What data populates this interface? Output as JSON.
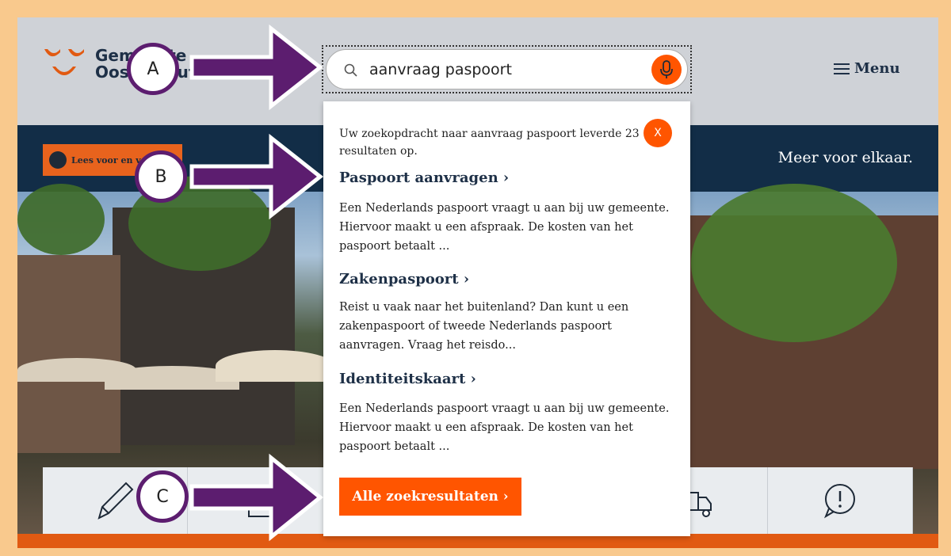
{
  "header": {
    "logo_line1": "Gemeente",
    "logo_line2": "Oosterhout",
    "menu_label": "Menu"
  },
  "search": {
    "value": "aanvraag paspoort",
    "placeholder": ""
  },
  "navband": {
    "read_aloud_label": "Lees voor en vertaal",
    "tagline": "Meer voor elkaar."
  },
  "results": {
    "summary": "Uw zoekopdracht naar aanvraag paspoort leverde 23 resultaten op.",
    "close_label": "X",
    "items": [
      {
        "title": "Paspoort aanvragen ›",
        "description": "Een Nederlands paspoort vraagt u aan bij uw gemeente. Hiervoor maakt u een afspraak. De kosten van het paspoort betaalt ..."
      },
      {
        "title": "Zakenpaspoort ›",
        "description": "Reist u vaak naar het buitenland? Dan kunt u een zakenpaspoort of tweede Nederlands paspoort aanvragen. Vraag het reisdo..."
      },
      {
        "title": "Identiteitskaart ›",
        "description": "Een Nederlands paspoort vraagt u aan bij uw gemeente. Hiervoor maakt u een afspraak. De kosten van het paspoort betaalt ..."
      }
    ],
    "all_results_label": "Alle zoekresultaten ›"
  },
  "annotations": {
    "a": "A",
    "b": "B",
    "c": "C"
  },
  "icons": {
    "logo": "logo-icon",
    "search": "search-icon",
    "mic": "microphone-icon",
    "menu": "hamburger-icon",
    "tiles": [
      "pencil-icon",
      "document-icon",
      "truck-icon",
      "alert-icon"
    ]
  },
  "colors": {
    "accent": "#ff5500",
    "navy": "#122d47",
    "annotation": "#5c1d6f"
  }
}
